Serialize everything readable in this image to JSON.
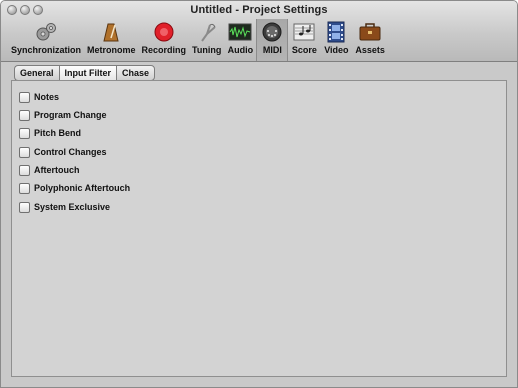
{
  "window": {
    "title": "Untitled - Project Settings"
  },
  "toolbar": {
    "items": [
      {
        "label": "Synchronization",
        "icon": "gears-icon"
      },
      {
        "label": "Metronome",
        "icon": "metronome-icon"
      },
      {
        "label": "Recording",
        "icon": "record-icon"
      },
      {
        "label": "Tuning",
        "icon": "tuning-fork-icon"
      },
      {
        "label": "Audio",
        "icon": "audio-waveform-icon"
      },
      {
        "label": "MIDI",
        "icon": "midi-port-icon",
        "selected": true
      },
      {
        "label": "Score",
        "icon": "score-icon"
      },
      {
        "label": "Video",
        "icon": "film-icon"
      },
      {
        "label": "Assets",
        "icon": "briefcase-icon"
      }
    ]
  },
  "tabs": [
    {
      "label": "General"
    },
    {
      "label": "Input Filter",
      "active": true
    },
    {
      "label": "Chase"
    }
  ],
  "filters": [
    {
      "label": "Notes",
      "checked": false
    },
    {
      "label": "Program Change",
      "checked": false
    },
    {
      "label": "Pitch Bend",
      "checked": false
    },
    {
      "label": "Control Changes",
      "checked": false
    },
    {
      "label": "Aftertouch",
      "checked": false
    },
    {
      "label": "Polyphonic Aftertouch",
      "checked": false
    },
    {
      "label": "System Exclusive",
      "checked": false
    }
  ],
  "colors": {
    "record": "#e0202a",
    "window_bg": "#c9c9c9",
    "panel_bg": "#d3d3d3"
  }
}
